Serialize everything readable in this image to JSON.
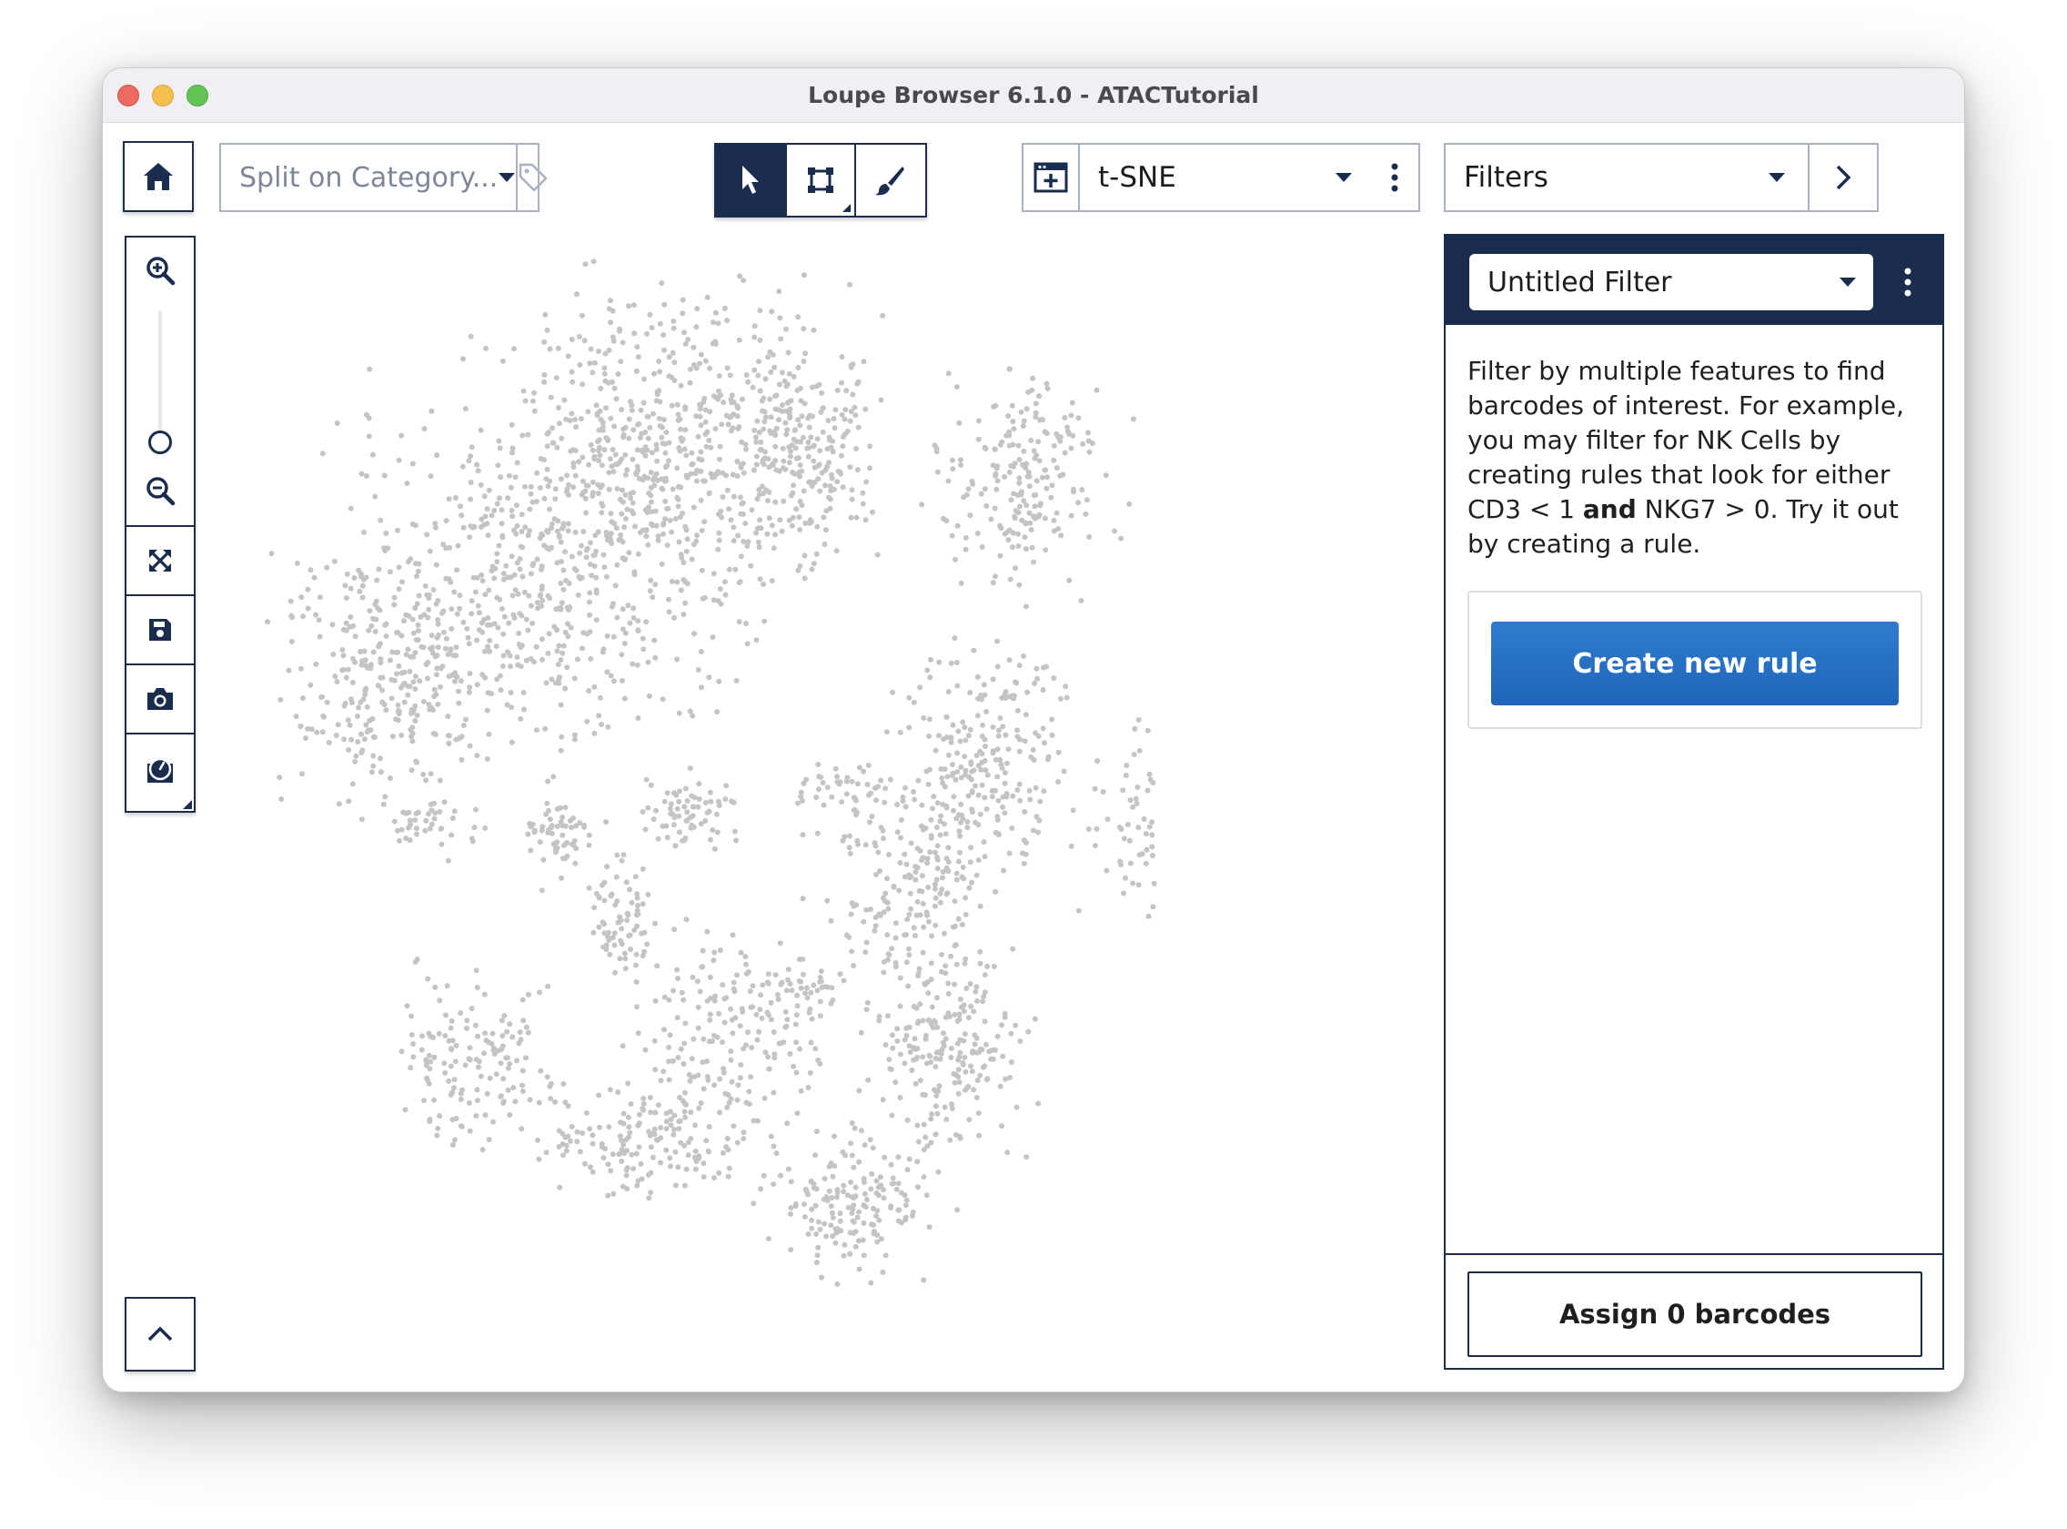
{
  "window": {
    "title": "Loupe Browser 6.1.0 - ATACTutorial"
  },
  "toolbar": {
    "split_placeholder": "Split on Category...",
    "projection": "t-SNE",
    "filters_label": "Filters"
  },
  "panel": {
    "filter_name": "Untitled Filter",
    "description_parts": {
      "p1": "Filter by multiple features to find barcodes of interest. For example, you may filter for NK Cells by creating rules that look for either CD3 < 1 ",
      "bold": "and",
      "p2": " NKG7 > 0. Try it out by creating a rule."
    },
    "create_rule_label": "Create new rule",
    "assign_label": "Assign 0 barcodes"
  },
  "colors": {
    "navy": "#1b2d4f",
    "accent_blue": "#2572c6",
    "point_gray": "#c4c4c4"
  },
  "icons": {
    "home": "home-icon",
    "tag": "tag-icon",
    "pointer": "pointer-icon",
    "lasso_rect": "rect-select-icon",
    "brush": "brush-icon",
    "projection": "projection-icon",
    "zoom_in": "zoom-in-icon",
    "zoom_out": "zoom-out-icon",
    "fit": "fit-view-icon",
    "save": "save-icon",
    "camera": "camera-icon",
    "dial": "gauge-icon",
    "collapse": "chevron-up-icon",
    "next": "chevron-right-icon"
  },
  "zoom_level": 0.3
}
